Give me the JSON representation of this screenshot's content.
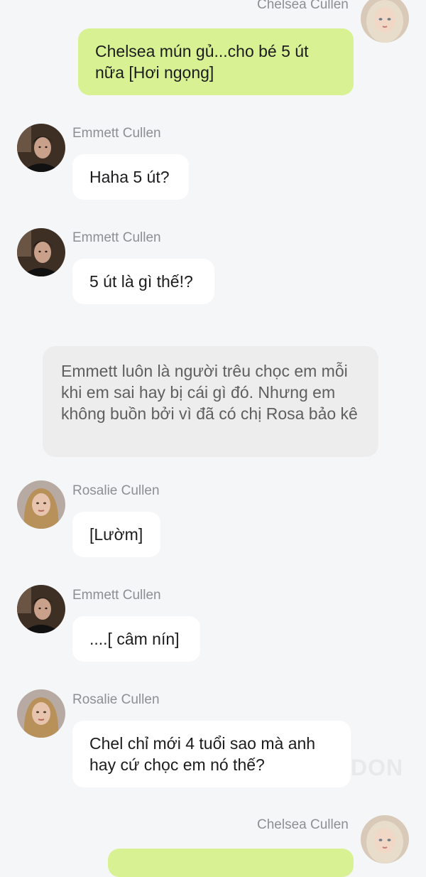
{
  "messages": [
    {
      "sender": "Chelsea Cullen",
      "text": "Chelsea mún gủ...cho bé 5 út\nnữa [Hơi ngọng]"
    },
    {
      "sender": "Emmett Cullen",
      "text": "Haha 5 út?"
    },
    {
      "sender": "Emmett Cullen",
      "text": "5 út là gì thế!?"
    },
    {
      "sender": "Rosalie Cullen",
      "text": "[Lườm]"
    },
    {
      "sender": "Emmett Cullen",
      "text": "....[ câm nín]"
    },
    {
      "sender": "Rosalie Cullen",
      "text": "Chel chỉ mới 4 tuổi sao mà anh\nhay cứ chọc em nó thế?"
    },
    {
      "sender": "Chelsea Cullen",
      "text": ""
    }
  ],
  "narration": "Emmett luôn là người trêu chọc em mỗi khi em sai hay bị cái gì đó. Nhưng em không buồn bởi vì đã có chị Rosa bảo kê",
  "colors": {
    "background": "#f5f6f8",
    "own_bubble": "#d8f293",
    "other_bubble": "#ffffff",
    "narration_bubble": "#ededed",
    "name_text": "#8e8e93"
  },
  "icons": {
    "chelsea": "avatar-chelsea",
    "emmett": "avatar-emmett",
    "rosalie": "avatar-rosalie"
  }
}
